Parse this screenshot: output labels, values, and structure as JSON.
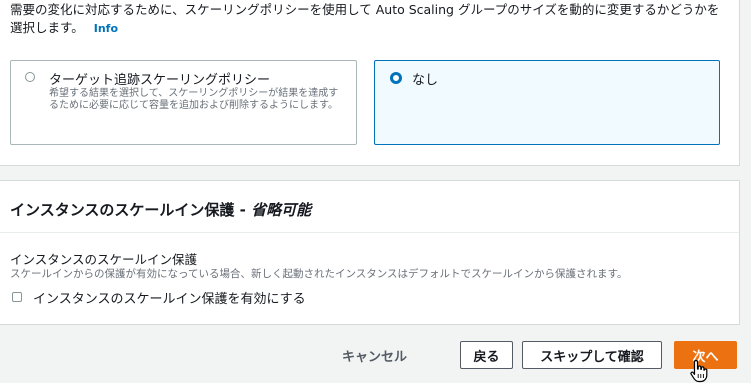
{
  "scaling_policy": {
    "description": "需要の変化に対応するために、スケーリングポリシーを使用して Auto Scaling グループのサイズを動的に変更するかどうかを選択します。",
    "info_link": "Info",
    "options": [
      {
        "title": "ターゲット追跡スケーリングポリシー",
        "description": "希望する結果を選択して、スケーリングポリシーが結果を達成するために必要に応じて容量を追加および削除するようにします。",
        "selected": false
      },
      {
        "title": "なし",
        "selected": true
      }
    ]
  },
  "scale_in_protection": {
    "section_title": "インスタンスのスケールイン保護 - ",
    "section_title_optional": "省略可能",
    "field_label": "インスタンスのスケールイン保護",
    "field_description": "スケールインからの保護が有効になっている場合、新しく起動されたインスタンスはデフォルトでスケールインから保護されます。",
    "checkbox_label": "インスタンスのスケールイン保護を有効にする",
    "checkbox_checked": false
  },
  "footer": {
    "cancel_label": "キャンセル",
    "back_label": "戻る",
    "skip_label": "スキップして確認",
    "next_label": "次へ"
  },
  "colors": {
    "primary": "#ec7211",
    "link": "#0073bb",
    "selected_card_bg": "#f1faff"
  },
  "icons": {
    "cursor": "hand-pointer-icon"
  }
}
